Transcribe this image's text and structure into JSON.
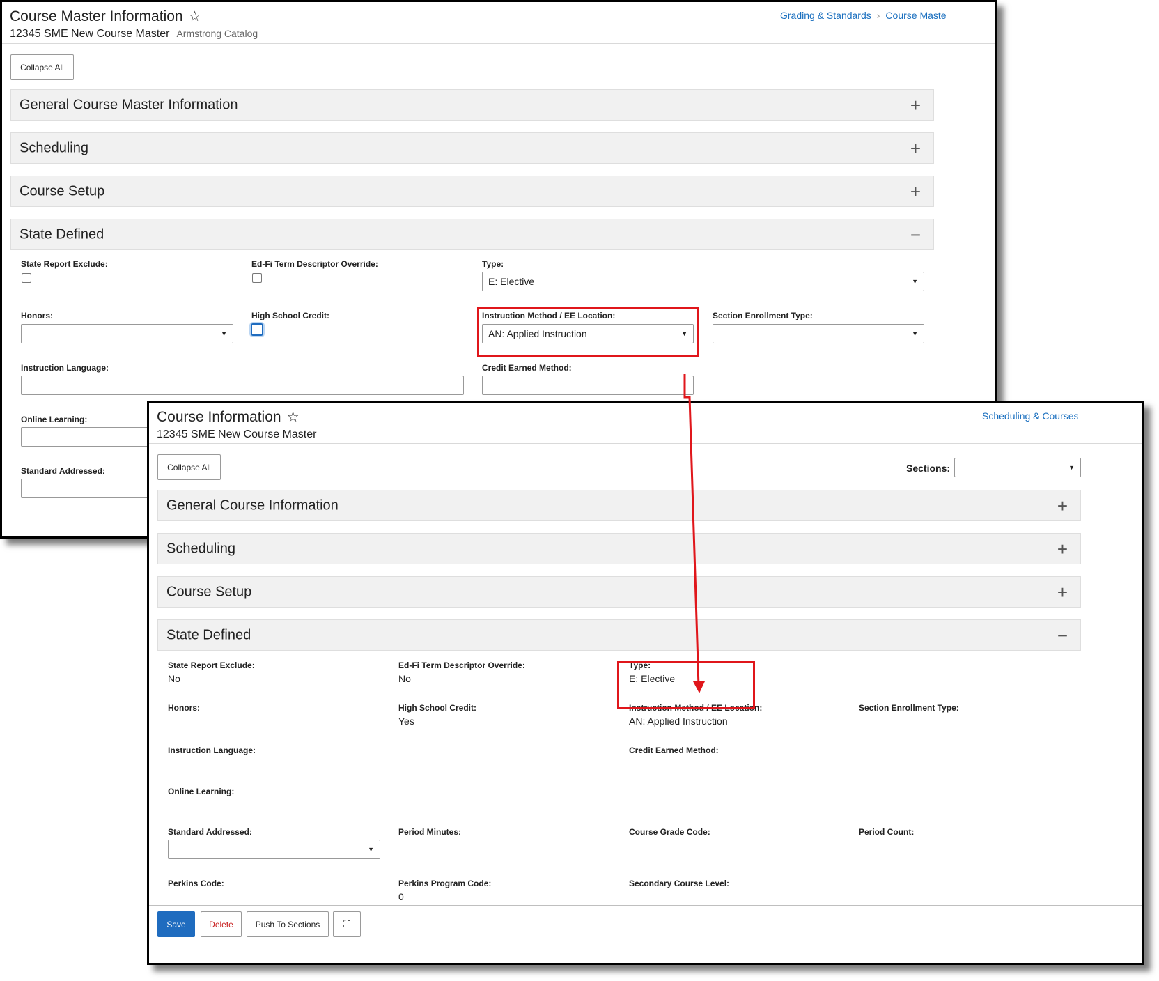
{
  "master": {
    "title": "Course Master Information",
    "subtitle": "12345 SME New Course Master",
    "catalog": "Armstrong Catalog",
    "breadcrumb": [
      "Grading & Standards",
      "Course Maste"
    ],
    "collapse_all": "Collapse All",
    "panels": {
      "general": "General Course Master Information",
      "scheduling": "Scheduling",
      "course_setup": "Course Setup",
      "state_defined": "State Defined"
    },
    "fields": {
      "state_report_exclude": "State Report Exclude:",
      "edfi_override": "Ed-Fi Term Descriptor Override:",
      "type": "Type:",
      "type_value": "E: Elective",
      "honors": "Honors:",
      "high_school_credit": "High School Credit:",
      "instruction_method": "Instruction Method / EE Location:",
      "instruction_method_value": "AN: Applied Instruction",
      "section_enrollment_type": "Section Enrollment Type:",
      "instruction_language": "Instruction Language:",
      "credit_earned_method": "Credit Earned Method:",
      "online_learning": "Online Learning:",
      "standard_addressed": "Standard Addressed:"
    }
  },
  "course": {
    "title": "Course Information",
    "subtitle": "12345 SME New Course Master",
    "breadcrumb": "Scheduling & Courses",
    "collapse_all": "Collapse All",
    "sections_label": "Sections:",
    "panels": {
      "general": "General Course Information",
      "scheduling": "Scheduling",
      "course_setup": "Course Setup",
      "state_defined": "State Defined"
    },
    "fields": {
      "state_report_exclude": "State Report Exclude:",
      "state_report_exclude_value": "No",
      "edfi_override": "Ed-Fi Term Descriptor Override:",
      "edfi_override_value": "No",
      "type": "Type:",
      "type_value": "E: Elective",
      "honors": "Honors:",
      "high_school_credit": "High School Credit:",
      "high_school_credit_value": "Yes",
      "instruction_method": "Instruction Method / EE Location:",
      "instruction_method_value": "AN: Applied Instruction",
      "section_enrollment_type": "Section Enrollment Type:",
      "instruction_language": "Instruction Language:",
      "credit_earned_method": "Credit Earned Method:",
      "online_learning": "Online Learning:",
      "standard_addressed": "Standard Addressed:",
      "period_minutes": "Period Minutes:",
      "course_grade_code": "Course Grade Code:",
      "period_count": "Period Count:",
      "perkins_code": "Perkins Code:",
      "perkins_program_code": "Perkins Program Code:",
      "perkins_program_code_value": "0",
      "secondary_course_level": "Secondary Course Level:"
    },
    "actions": {
      "save": "Save",
      "delete": "Delete",
      "push": "Push To Sections"
    }
  },
  "colors": {
    "highlight": "#e0161b",
    "link": "#1a6fbf",
    "primary": "#1f6cbf",
    "danger": "#c81e1e"
  },
  "icons": {
    "favorite": "star-outline-icon",
    "expand": "plus-icon",
    "collapse": "minus-icon",
    "dropdown": "caret-down-icon",
    "fullscreen": "expand-icon",
    "breadcrumb_sep": "chevron-right-icon"
  }
}
